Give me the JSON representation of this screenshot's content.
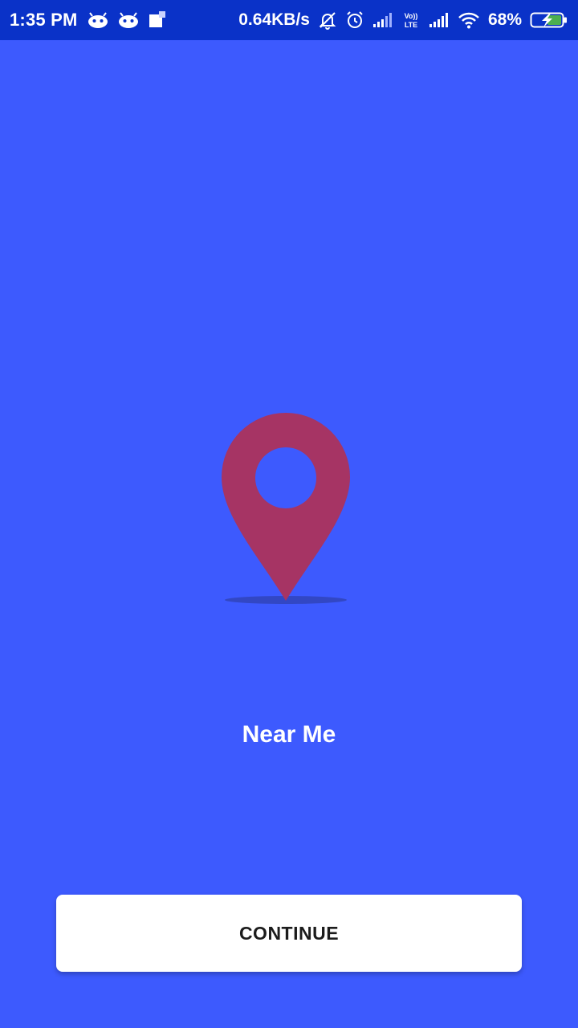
{
  "status_bar": {
    "time": "1:35 PM",
    "network_speed": "0.64KB/s",
    "battery_percent": "68%",
    "icons": {
      "left": [
        "android-icon",
        "android-icon",
        "notification-square-icon"
      ],
      "right": [
        "muted-bell-icon",
        "alarm-icon",
        "signal-icon",
        "volte-lte-icon",
        "signal-icon",
        "wifi-icon",
        "battery-charging-icon"
      ]
    }
  },
  "main": {
    "pin_icon": "location-pin-icon",
    "title": "Near Me"
  },
  "footer": {
    "continue_label": "CONTINUE"
  },
  "colors": {
    "background": "#3d5afe",
    "status_bar": "#0a32c8",
    "pin": "#a63464",
    "pin_shadow": "#3247c4",
    "button_bg": "#ffffff",
    "button_text": "#1c1c1c",
    "battery_fill": "#4caf50"
  }
}
